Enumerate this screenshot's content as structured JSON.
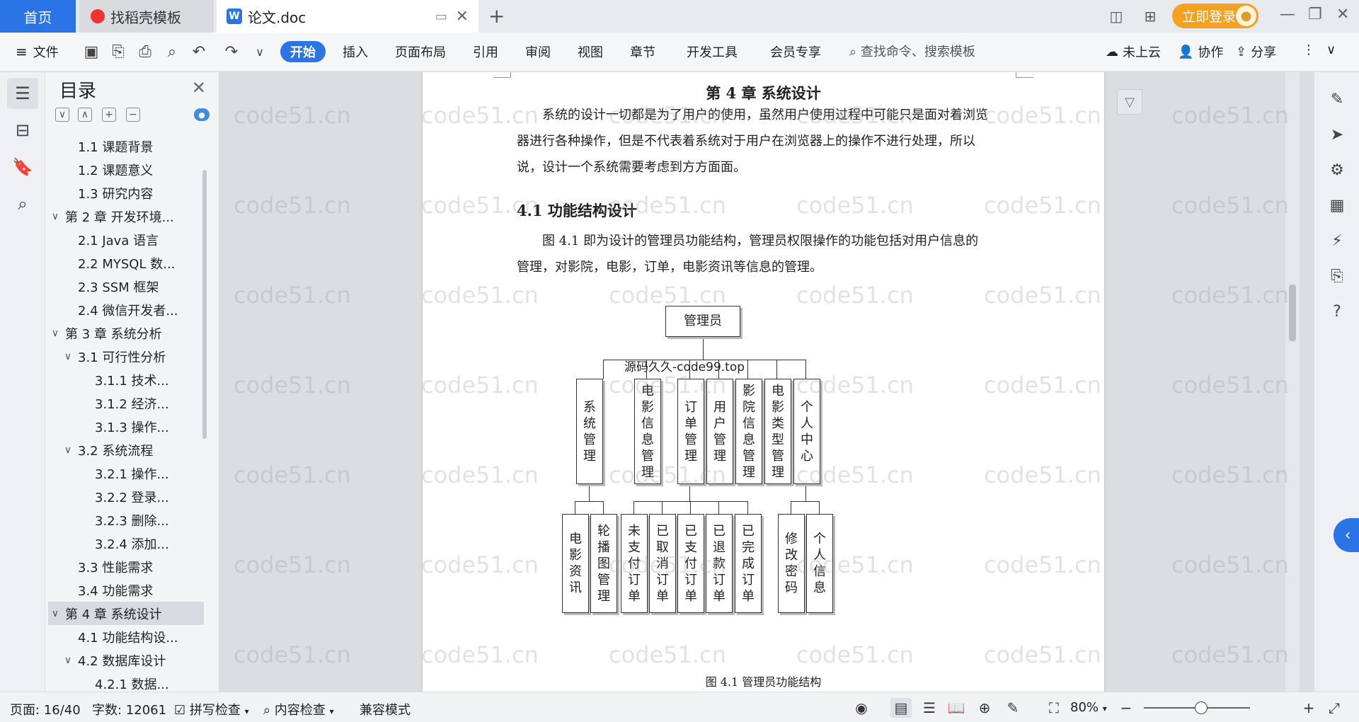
{
  "titlebar": {
    "tab_home": "首页",
    "tab_daoke": "找稻壳模板",
    "tab_doc": "论文.doc",
    "login": "立即登录"
  },
  "menubar": {
    "file": "文件",
    "start": "开始",
    "insert": "插入",
    "layout": "页面布局",
    "reference": "引用",
    "review": "审阅",
    "view": "视图",
    "chapter": "章节",
    "devtools": "开发工具",
    "member": "会员专享",
    "search_placeholder": "查找命令、搜索模板",
    "cloud": "未上云",
    "collab": "协作",
    "share": "分享"
  },
  "toc": {
    "title": "目录",
    "items": [
      {
        "label": "1.1 课题背景",
        "level": 2,
        "caret": ""
      },
      {
        "label": "1.2 课题意义",
        "level": 2,
        "caret": ""
      },
      {
        "label": "1.3 研究内容",
        "level": 2,
        "caret": ""
      },
      {
        "label": "第 2 章 开发环境...",
        "level": 1,
        "caret": "∨"
      },
      {
        "label": "2.1 Java 语言",
        "level": 2,
        "caret": ""
      },
      {
        "label": "2.2 MYSQL 数...",
        "level": 2,
        "caret": ""
      },
      {
        "label": "2.3 SSM 框架",
        "level": 2,
        "caret": ""
      },
      {
        "label": "2.4 微信开发者...",
        "level": 2,
        "caret": ""
      },
      {
        "label": "第 3 章 系统分析",
        "level": 1,
        "caret": "∨"
      },
      {
        "label": "3.1 可行性分析",
        "level": 2,
        "caret": "∨"
      },
      {
        "label": "3.1.1 技术...",
        "level": 3,
        "caret": ""
      },
      {
        "label": "3.1.2 经济...",
        "level": 3,
        "caret": ""
      },
      {
        "label": "3.1.3 操作...",
        "level": 3,
        "caret": ""
      },
      {
        "label": "3.2 系统流程",
        "level": 2,
        "caret": "∨"
      },
      {
        "label": "3.2.1 操作...",
        "level": 3,
        "caret": ""
      },
      {
        "label": "3.2.2 登录...",
        "level": 3,
        "caret": ""
      },
      {
        "label": "3.2.3 删除...",
        "level": 3,
        "caret": ""
      },
      {
        "label": "3.2.4 添加...",
        "level": 3,
        "caret": ""
      },
      {
        "label": "3.3 性能需求",
        "level": 2,
        "caret": ""
      },
      {
        "label": "3.4 功能需求",
        "level": 2,
        "caret": ""
      },
      {
        "label": "第 4 章 系统设计",
        "level": 1,
        "caret": "∨",
        "selected": true
      },
      {
        "label": "4.1 功能结构设...",
        "level": 2,
        "caret": ""
      },
      {
        "label": "4.2 数据库设计",
        "level": 2,
        "caret": "∨"
      },
      {
        "label": "4.2.1 数据...",
        "level": 3,
        "caret": ""
      }
    ]
  },
  "document": {
    "chapter_title": "第 4 章  系统设计",
    "para1": "系统的设计一切都是为了用户的使用，虽然用户使用过程中可能只是面对着浏览器进行各种操作，但是不代表着系统对于用户在浏览器上的操作不进行处理，所以说，设计一个系统需要考虑到方方面面。",
    "section_title": "4.1  功能结构设计",
    "para2": "图 4.1 即为设计的管理员功能结构，管理员权限操作的功能包括对用户信息的管理，对影院，电影，订单，电影资讯等信息的管理。",
    "source_label": "源码久久-code99.top",
    "figure_caption": "图 4.1  管理员功能结构",
    "watermark": "code51.cn",
    "diagram": {
      "root": "管理员",
      "level1": [
        "系统管理",
        "电影信息管理",
        "订单管理",
        "用户管理",
        "影院信息管理",
        "电影类型管理",
        "个人中心"
      ],
      "level2_system": [
        "电影资讯",
        "轮播图管理"
      ],
      "level2_order": [
        "未支付订单",
        "已取消订单",
        "已支付订单",
        "已退款订单",
        "已完成订单"
      ],
      "level2_personal": [
        "修改密码",
        "个人信息"
      ]
    }
  },
  "statusbar": {
    "page": "页面: 16/40",
    "words": "字数: 12061",
    "spell": "拼写检查",
    "content_check": "内容检查",
    "compat": "兼容模式",
    "zoom": "80%"
  }
}
